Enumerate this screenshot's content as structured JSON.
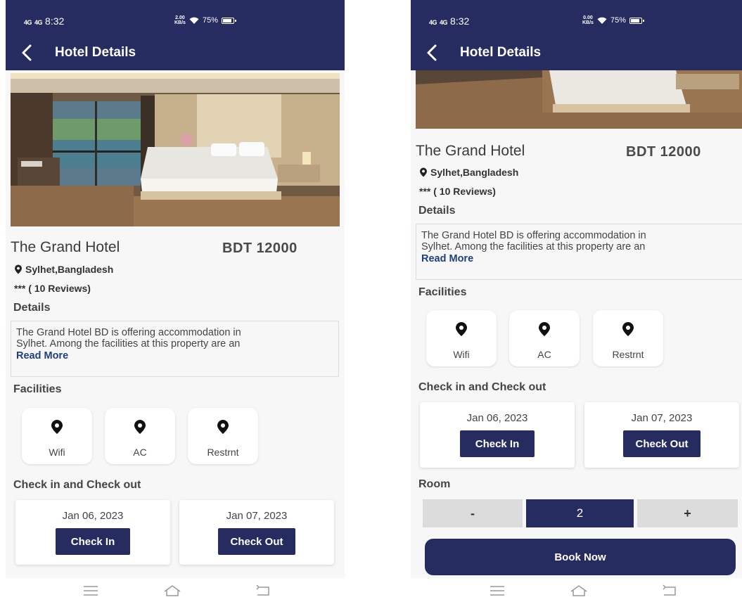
{
  "status_bar": {
    "network_1": "4G",
    "network_2": "4G",
    "time": "8:32",
    "left_speed_value": "2.00",
    "right_speed_value": "0.00",
    "speed_unit": "KB/s",
    "battery": "75%"
  },
  "app_bar": {
    "title": "Hotel Details"
  },
  "hotel": {
    "name": "The Grand Hotel",
    "price": "BDT 12000",
    "location": "Sylhet,Bangladesh",
    "reviews": "*** ( 10 Reviews)"
  },
  "details": {
    "title": "Details",
    "line1": "The Grand Hotel BD is offering accommodation in",
    "line2": "Sylhet. Among the facilities at this property are an",
    "read_more": "Read More"
  },
  "facilities": {
    "title": "Facilities",
    "items": [
      {
        "label": "Wifi",
        "icon": "location-pin-icon"
      },
      {
        "label": "AC",
        "icon": "location-pin-icon"
      },
      {
        "label": "Restrnt",
        "icon": "location-pin-icon"
      }
    ]
  },
  "checkin": {
    "title": "Check in and Check out",
    "checkin_date": "Jan 06, 2023",
    "checkin_label": "Check In",
    "checkout_date": "Jan 07, 2023",
    "checkout_label": "Check Out"
  },
  "room": {
    "title": "Room",
    "minus": "-",
    "count": "2",
    "plus": "+"
  },
  "book_now": "Book Now",
  "colors": {
    "primary": "#262c60",
    "link": "#1e3f7a",
    "background": "#f7f7f8"
  }
}
